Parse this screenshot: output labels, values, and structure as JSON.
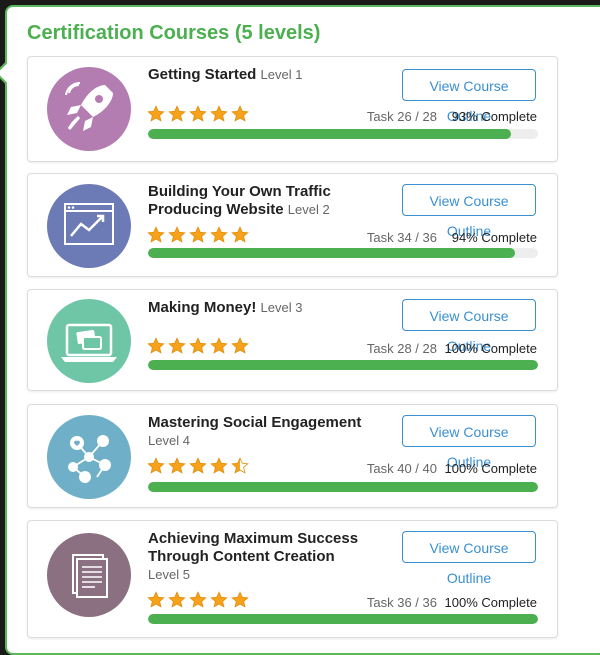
{
  "title": "Certification Courses (5 levels)",
  "button_label": "View Course Outline",
  "colors": {
    "accent": "#4caf50",
    "link": "#3a8fd1",
    "star": "#f7a21a"
  },
  "courses": [
    {
      "name": "Getting Started",
      "level": "Level 1",
      "task": "Task 26 / 28",
      "pct_text": "93% Complete",
      "progress": 93,
      "stars": 5,
      "icon": "rocket-icon",
      "icon_color": "#b47db1"
    },
    {
      "name": "Building Your Own Traffic Producing Website",
      "level": "Level 2",
      "task": "Task 34 / 36",
      "pct_text": "94% Complete",
      "progress": 94,
      "stars": 5,
      "icon": "growth-chart-icon",
      "icon_color": "#6c7bb6"
    },
    {
      "name": "Making Money!",
      "level": "Level 3",
      "task": "Task 28 / 28",
      "pct_text": "100% Complete",
      "progress": 100,
      "stars": 5,
      "icon": "laptop-credit-card-icon",
      "icon_color": "#6fc6a6"
    },
    {
      "name": "Mastering Social Engagement",
      "level": "Level 4",
      "task": "Task 40 / 40",
      "pct_text": "100% Complete",
      "progress": 100,
      "stars": 4.5,
      "icon": "social-network-icon",
      "icon_color": "#6fb0c8"
    },
    {
      "name": "Achieving Maximum Success Through Content Creation",
      "level": "Level 5",
      "task": "Task 36 / 36",
      "pct_text": "100% Complete",
      "progress": 100,
      "stars": 5,
      "icon": "documents-icon",
      "icon_color": "#8a7080"
    }
  ]
}
